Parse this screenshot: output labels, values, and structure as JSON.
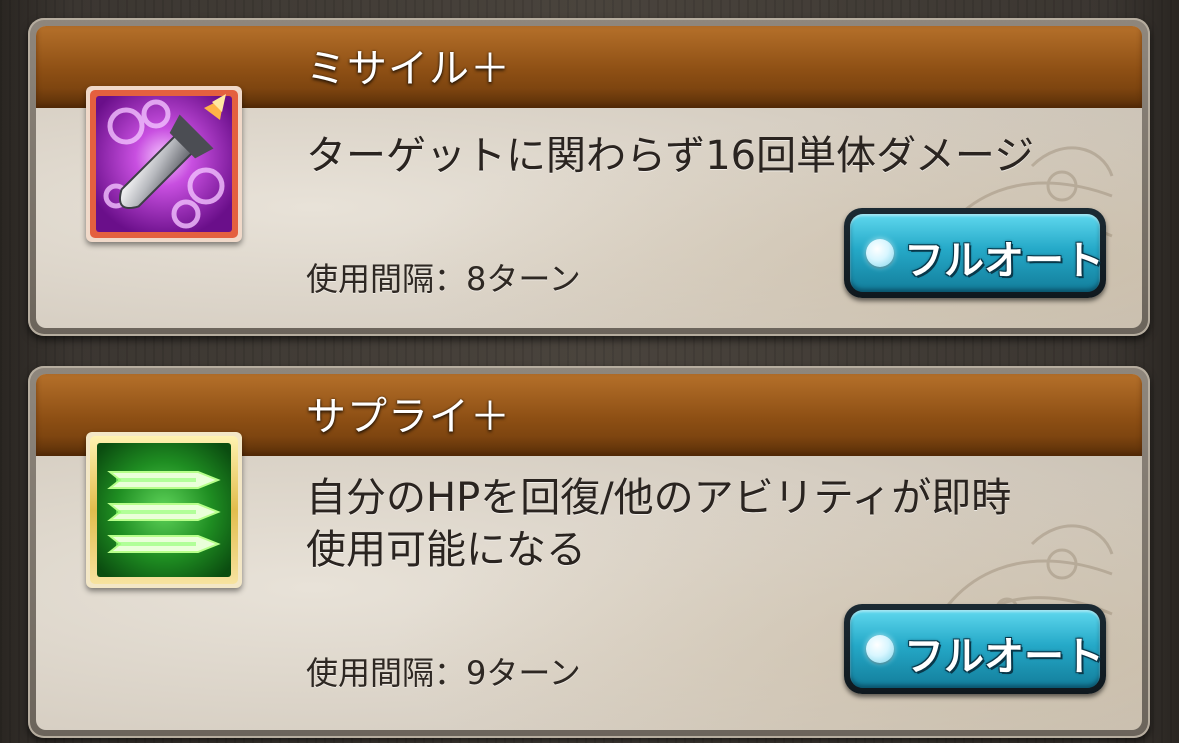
{
  "abilities": [
    {
      "name": "ミサイル＋",
      "description": "ターゲットに関わらず16回単体ダメージ",
      "cooldown": "使用間隔：8ターン",
      "auto_button_label": "フルオート",
      "icon": "missile-icon",
      "frame_color": "#e45a3a"
    },
    {
      "name": "サプライ＋",
      "description_line1": "自分のHPを回復/他のアビリティが即時",
      "description_line2": "使用可能になる",
      "cooldown": "使用間隔：9ターン",
      "auto_button_label": "フルオート",
      "icon": "supply-arrows-icon",
      "frame_color": "#e8c75a"
    }
  ],
  "colors": {
    "header_band": "#8d4f14",
    "button_accent": "#25a9c8",
    "panel_bg": "#d6cec2"
  }
}
